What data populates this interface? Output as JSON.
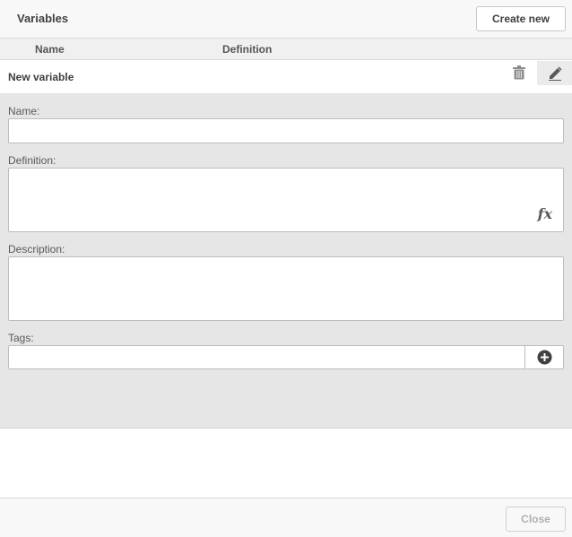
{
  "header": {
    "title": "Variables",
    "create_label": "Create new"
  },
  "columns": {
    "name": "Name",
    "definition": "Definition"
  },
  "row": {
    "label": "New variable",
    "trash_icon": "trash-icon",
    "edit_icon": "pencil-icon"
  },
  "form": {
    "name_label": "Name:",
    "name_value": "",
    "definition_label": "Definition:",
    "definition_value": "",
    "fx_label": "fx",
    "description_label": "Description:",
    "description_value": "",
    "tags_label": "Tags:",
    "tags_value": "",
    "add_tag_icon": "plus-circle-icon"
  },
  "footer": {
    "close_label": "Close"
  },
  "colors": {
    "panel": "#e6e6e6",
    "header": "#f8f8f8",
    "text": "#404040",
    "disabled": "#b0b0b0"
  }
}
